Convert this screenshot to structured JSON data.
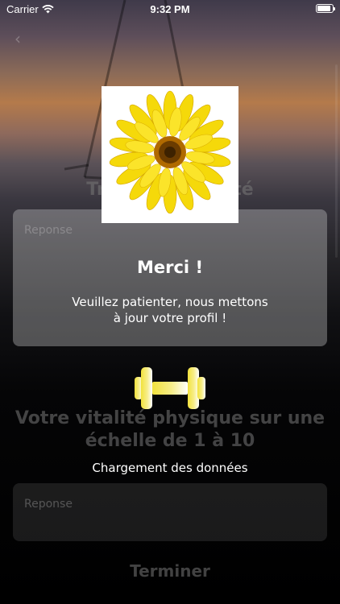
{
  "status_bar": {
    "carrier": "Carrier",
    "time": "9:32 PM",
    "wifi_icon": "wifi-icon",
    "battery_icon": "battery-icon"
  },
  "nav": {
    "back_icon": "chevron-left-icon"
  },
  "background": {
    "question_1": "Trouble de santé",
    "answer_1_placeholder": "Reponse",
    "question_2_line1": "Votre vitalité physique sur une",
    "question_2_line2": "échelle de 1 à 10",
    "answer_2_placeholder": "Reponse",
    "finish_button": "Terminer"
  },
  "overlay": {
    "image_icon": "sunflower-image",
    "title": "Merci !",
    "message_line1": "Veuillez patienter, nous mettons",
    "message_line2": "à jour votre profil !",
    "loader_icon": "dumbbell-icon",
    "loading_label": "Chargement des données"
  },
  "colors": {
    "accent_yellow": "#f2e23c",
    "text_white": "#ffffff"
  }
}
